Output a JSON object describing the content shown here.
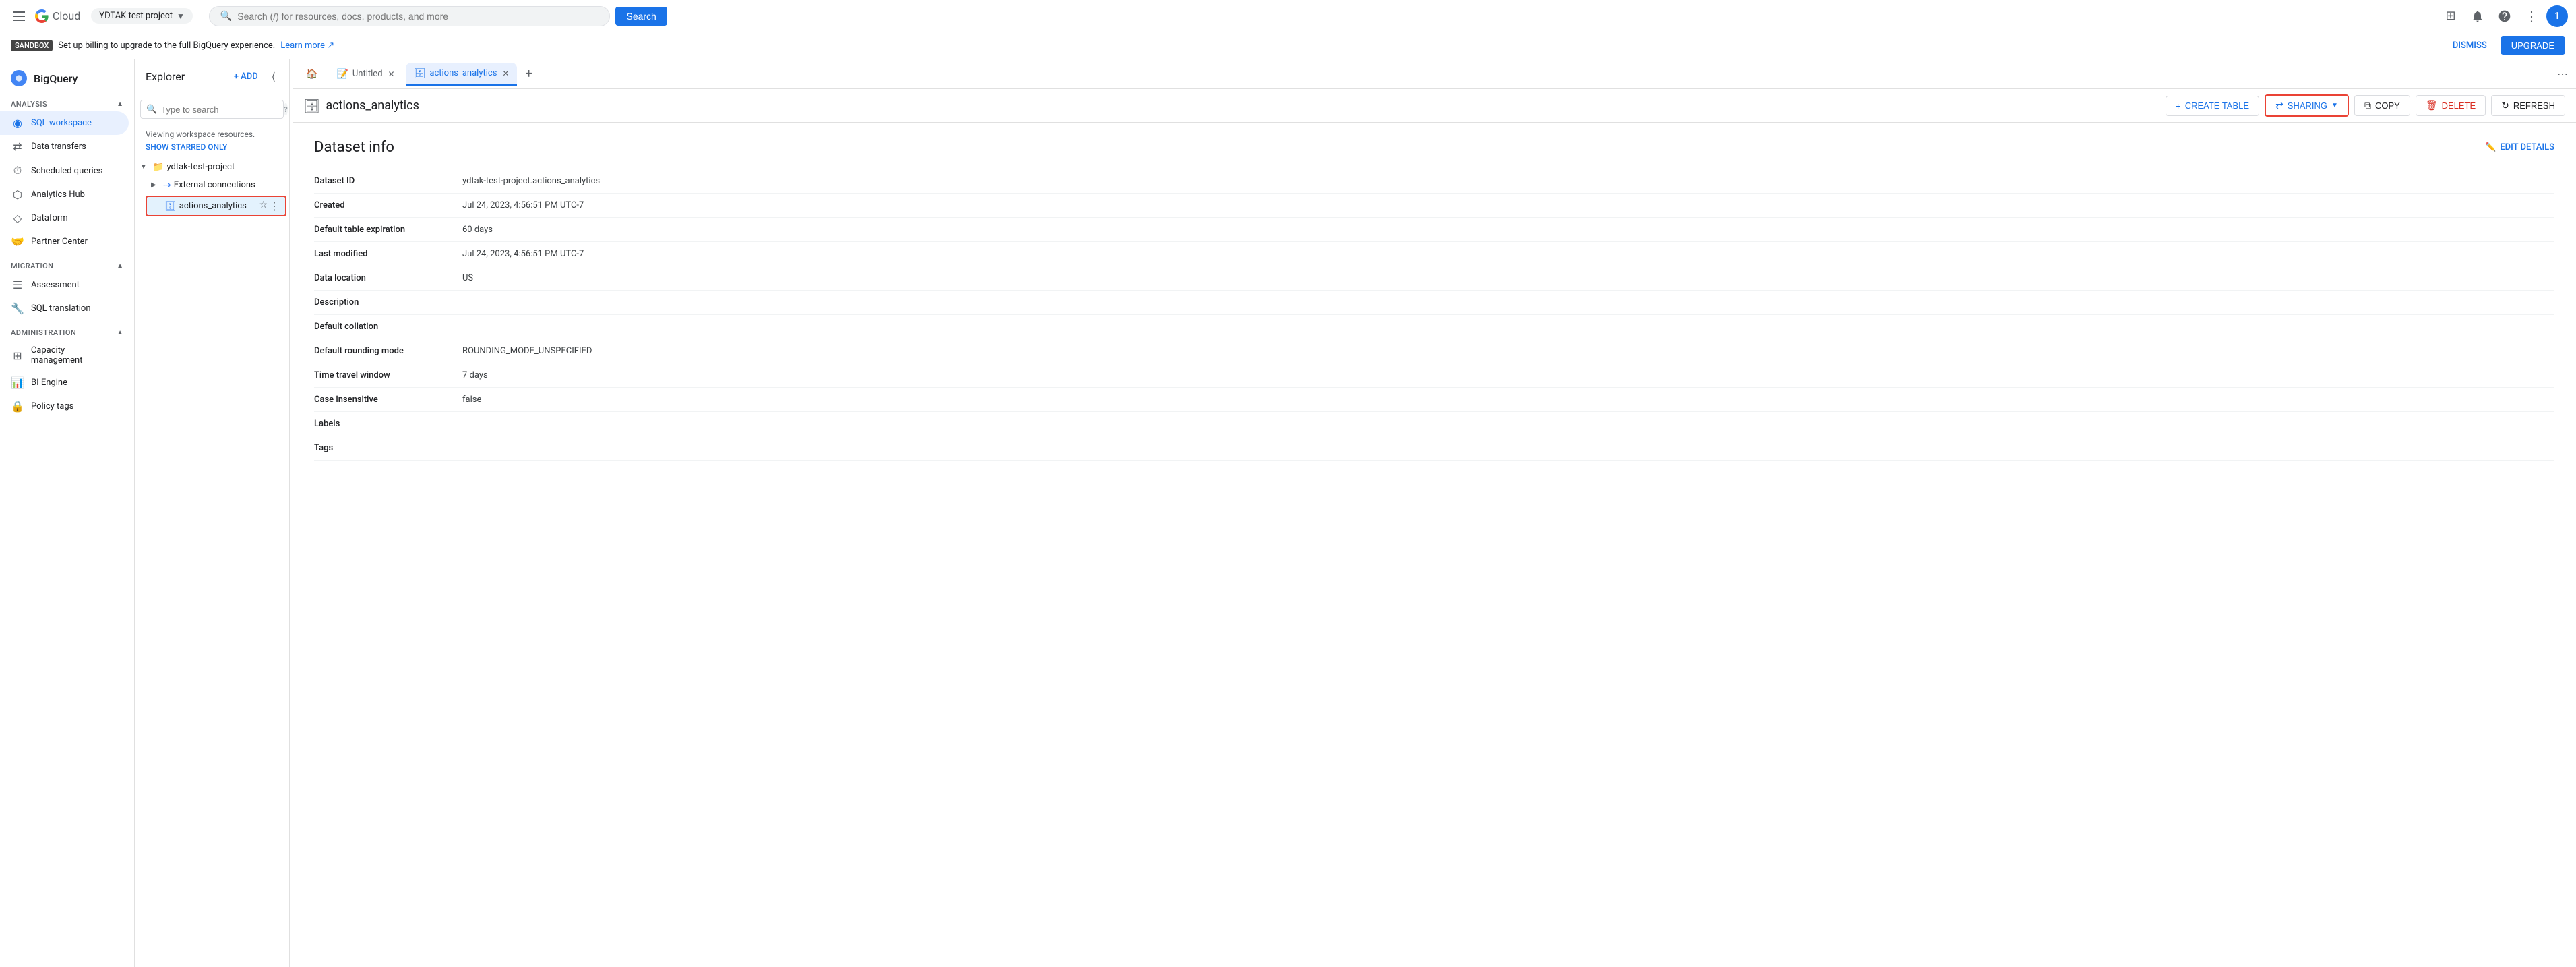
{
  "topNav": {
    "menuIcon": "☰",
    "googleText": "Google",
    "cloudText": "Cloud",
    "projectName": "YDTAK test project",
    "searchPlaceholder": "Search (/) for resources, docs, products, and more",
    "searchButton": "Search",
    "appsIcon": "⊞",
    "notificationsIcon": "🔔",
    "helpIcon": "?",
    "moreIcon": "⋮",
    "avatarText": "1"
  },
  "sidebar": {
    "title": "BigQuery",
    "sections": [
      {
        "name": "Analysis",
        "collapsible": true,
        "items": [
          {
            "id": "sql-workspace",
            "label": "SQL workspace",
            "icon": "◉",
            "active": true
          },
          {
            "id": "data-transfers",
            "label": "Data transfers",
            "icon": "⇄"
          },
          {
            "id": "scheduled-queries",
            "label": "Scheduled queries",
            "icon": "⏱"
          },
          {
            "id": "analytics-hub",
            "label": "Analytics Hub",
            "icon": "⬡"
          },
          {
            "id": "dataform",
            "label": "Dataform",
            "icon": "◇"
          },
          {
            "id": "partner-center",
            "label": "Partner Center",
            "icon": "🤝"
          }
        ]
      },
      {
        "name": "Migration",
        "collapsible": true,
        "items": [
          {
            "id": "assessment",
            "label": "Assessment",
            "icon": "☰"
          },
          {
            "id": "sql-translation",
            "label": "SQL translation",
            "icon": "🔧"
          }
        ]
      },
      {
        "name": "Administration",
        "collapsible": true,
        "items": [
          {
            "id": "capacity-management",
            "label": "Capacity management",
            "icon": "⊞"
          },
          {
            "id": "bi-engine",
            "label": "BI Engine",
            "icon": "📊"
          },
          {
            "id": "policy-tags",
            "label": "Policy tags",
            "icon": "🔒"
          }
        ]
      }
    ]
  },
  "explorer": {
    "title": "Explorer",
    "addLabel": "+ ADD",
    "searchPlaceholder": "Type to search",
    "workspaceText": "Viewing workspace resources.",
    "showStarredLabel": "SHOW STARRED ONLY",
    "projectName": "ydtak-test-project",
    "externalConnections": "External connections",
    "actionsDataset": "actions_analytics"
  },
  "sandbox": {
    "badgeText": "SANDBOX",
    "message": "Set up billing to upgrade to the full BigQuery experience.",
    "linkText": "Learn more",
    "dismissLabel": "DISMISS",
    "upgradeLabel": "UPGRADE"
  },
  "tabs": [
    {
      "id": "home",
      "icon": "🏠",
      "active": false,
      "closeable": false
    },
    {
      "id": "untitled",
      "label": "Untitled",
      "icon": "📝",
      "active": false,
      "closeable": true
    },
    {
      "id": "actions-analytics",
      "label": "actions_analytics",
      "icon": "🗄",
      "active": true,
      "closeable": true
    }
  ],
  "toolbar": {
    "datasetName": "actions_analytics",
    "createTableLabel": "CREATE TABLE",
    "sharingLabel": "SHARING",
    "copyLabel": "COPY",
    "deleteLabel": "DELETE",
    "refreshLabel": "REFRESH",
    "editDetailsLabel": "EDIT DETAILS"
  },
  "datasetInfo": {
    "title": "Dataset info",
    "fields": [
      {
        "label": "Dataset ID",
        "value": "ydtak-test-project.actions_analytics"
      },
      {
        "label": "Created",
        "value": "Jul 24, 2023, 4:56:51 PM UTC-7"
      },
      {
        "label": "Default table expiration",
        "value": "60 days"
      },
      {
        "label": "Last modified",
        "value": "Jul 24, 2023, 4:56:51 PM UTC-7"
      },
      {
        "label": "Data location",
        "value": "US"
      },
      {
        "label": "Description",
        "value": ""
      },
      {
        "label": "Default collation",
        "value": ""
      },
      {
        "label": "Default rounding mode",
        "value": "ROUNDING_MODE_UNSPECIFIED"
      },
      {
        "label": "Time travel window",
        "value": "7 days"
      },
      {
        "label": "Case insensitive",
        "value": "false"
      },
      {
        "label": "Labels",
        "value": ""
      },
      {
        "label": "Tags",
        "value": ""
      }
    ]
  }
}
